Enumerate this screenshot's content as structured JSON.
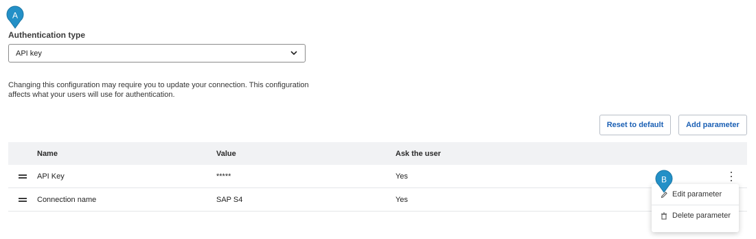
{
  "auth": {
    "label": "Authentication type",
    "selected": "API key",
    "note": "Changing this configuration may require you to update your connection. This configuration affects what your users will use for authentication."
  },
  "buttons": {
    "reset": "Reset to default",
    "add": "Add parameter"
  },
  "table": {
    "headers": {
      "name": "Name",
      "value": "Value",
      "ask": "Ask the user"
    },
    "rows": [
      {
        "name": "API Key",
        "value": "*****",
        "ask": "Yes"
      },
      {
        "name": "Connection name",
        "value": "SAP S4",
        "ask": "Yes"
      }
    ]
  },
  "menu": {
    "edit": "Edit parameter",
    "delete": "Delete parameter"
  },
  "markers": {
    "a": "A",
    "b": "B"
  },
  "icons": {
    "select_chevron": "chevron-down-icon",
    "drag": "drag-handle-icon",
    "kebab": "more-vertical-icon",
    "edit": "pencil-icon",
    "delete": "trash-icon"
  },
  "colors": {
    "accent": "#1a5fb4",
    "marker": "#2390c7"
  }
}
